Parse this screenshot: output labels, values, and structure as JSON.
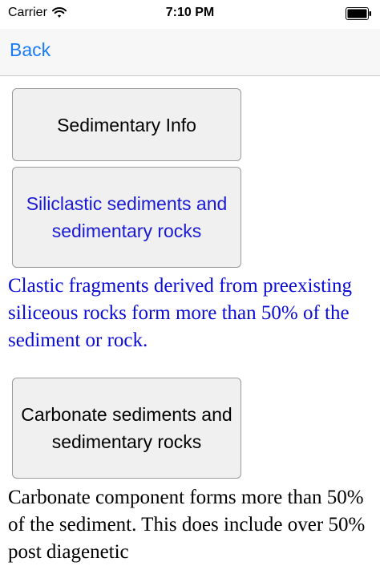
{
  "status_bar": {
    "carrier": "Carrier",
    "time": "7:10 PM",
    "icons": [
      "wifi-icon",
      "battery-icon"
    ]
  },
  "nav": {
    "back_label": "Back"
  },
  "buttons": {
    "sedimentary_info": "Sedimentary Info",
    "siliclastic": "Siliclastic sediments and sedimentary rocks",
    "carbonate": "Carbonate sediments and sedimentary rocks"
  },
  "descriptions": {
    "siliclastic": "Clastic fragments derived from preexisting siliceous rocks form more than 50% of the sediment or rock.",
    "carbonate": "Carbonate component forms more than 50% of the sediment. This does include over 50% post diagenetic"
  },
  "colors": {
    "link_blue": "#1a7cf5",
    "text_blue": "#0b0bd6",
    "button_bg": "#f0f0f0"
  }
}
